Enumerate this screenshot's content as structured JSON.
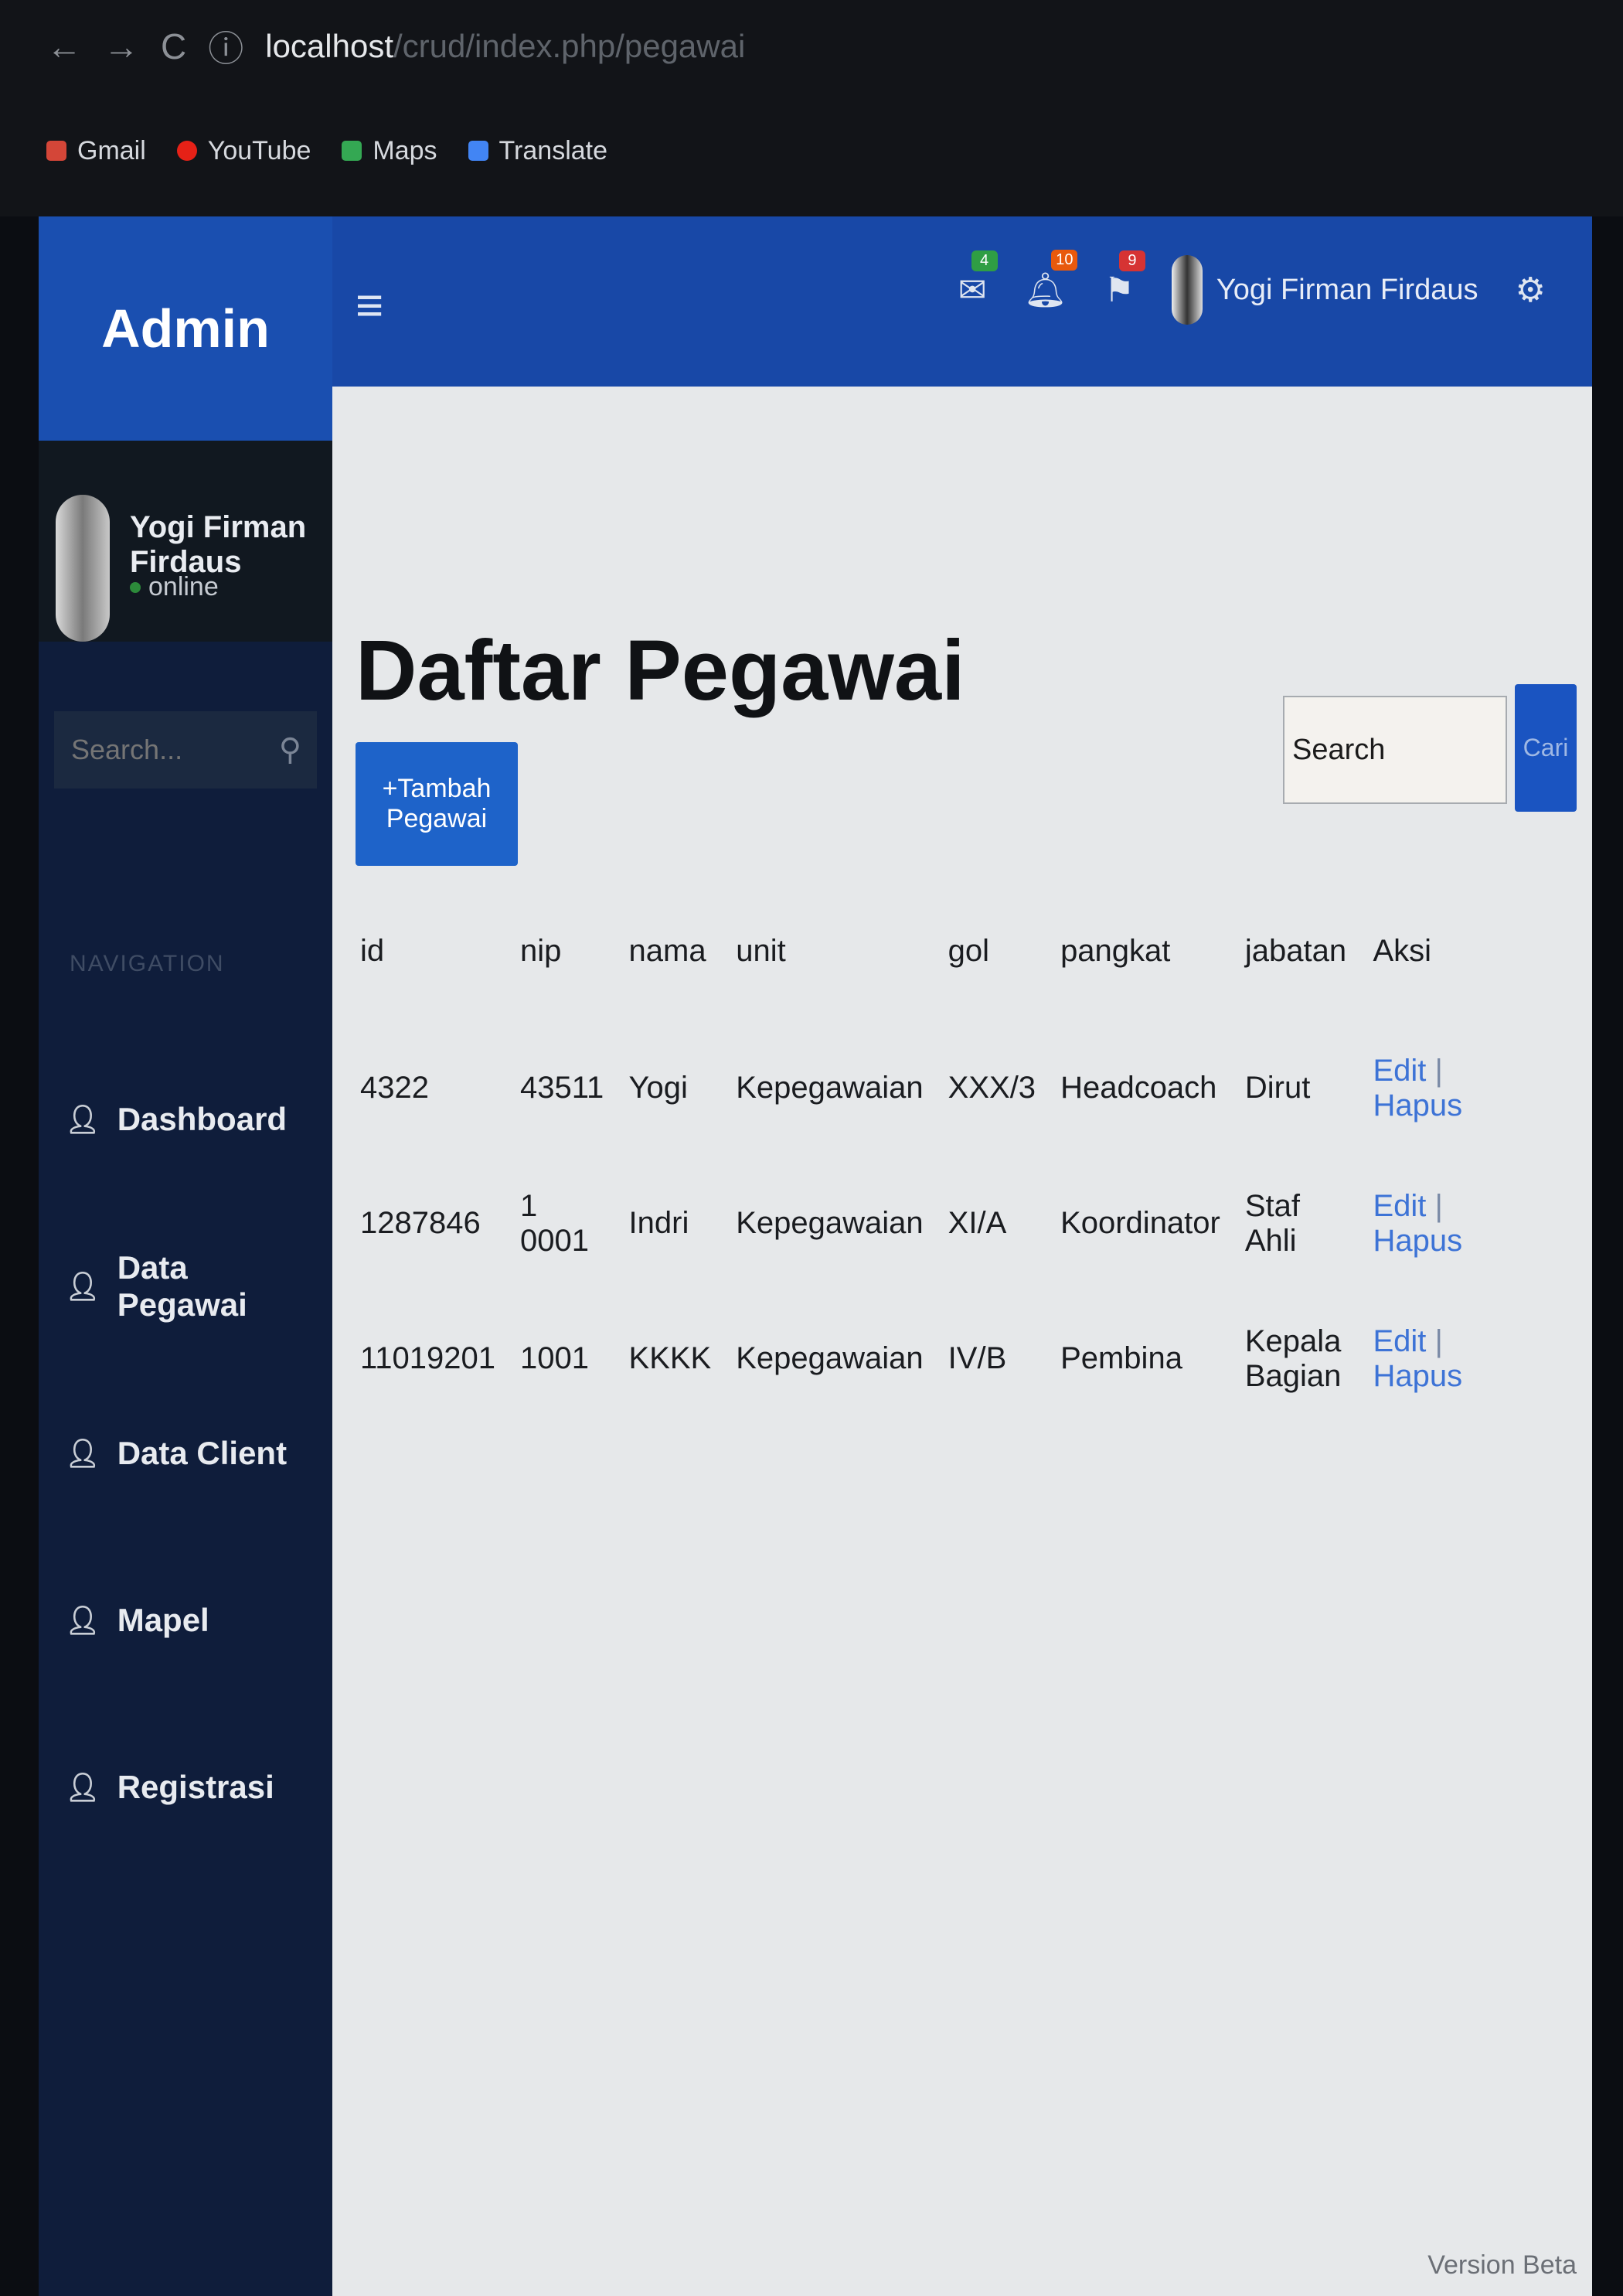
{
  "browser": {
    "url": "localhost",
    "url_path": "/crud/index.php/pegawai",
    "bookmarks": [
      {
        "label": "Gmail",
        "icon": "gmail-icon",
        "color": "#d44638"
      },
      {
        "label": "YouTube",
        "icon": "youtube-icon",
        "color": "#e62117"
      },
      {
        "label": "Maps",
        "icon": "maps-icon",
        "color": "#34a853"
      },
      {
        "label": "Translate",
        "icon": "translate-icon",
        "color": "#4285f4"
      }
    ]
  },
  "sidebar": {
    "brand": "Admin",
    "user": {
      "name": "Yogi Firman Firdaus",
      "status": "online"
    },
    "search_placeholder": "Search...",
    "nav_header": "NAVIGATION",
    "items": [
      {
        "label": "Dashboard"
      },
      {
        "label": "Data Pegawai"
      },
      {
        "label": "Data Client"
      },
      {
        "label": "Mapel"
      },
      {
        "label": "Registrasi"
      }
    ]
  },
  "topbar": {
    "messages_count": "4",
    "notifications_count": "10",
    "tasks_count": "9",
    "user_name": "Yogi Firman Firdaus",
    "colors": {
      "messages_badge": "#2f9e44",
      "notifications_badge": "#e8590c",
      "tasks_badge": "#d63333"
    }
  },
  "main": {
    "title": "Daftar Pegawai",
    "add_button": "+Tambah Pegawai",
    "search_placeholder": "Search",
    "search_button": "Cari",
    "table": {
      "headers": [
        "id",
        "nip",
        "nama",
        "unit",
        "gol",
        "pangkat",
        "jabatan",
        "Aksi"
      ],
      "rows": [
        {
          "id": "4322",
          "nip": "43511",
          "nama": "Yogi",
          "unit": "Kepegawaian",
          "gol": "XXX/3",
          "pangkat": "Headcoach",
          "jabatan": "Dirut"
        },
        {
          "id": "1287846",
          "nip": "1 0001",
          "nama": "Indri",
          "unit": "Kepegawaian",
          "gol": "XI/A",
          "pangkat": "Koordinator",
          "jabatan": "Staf Ahli"
        },
        {
          "id": "11019201",
          "nip": "1001",
          "nama": "KKKK",
          "unit": "Kepegawaian",
          "gol": "IV/B",
          "pangkat": "Pembina",
          "jabatan": "Kepala Bagian"
        }
      ],
      "action_edit": "Edit",
      "action_separator": "|",
      "action_delete": "Hapus"
    },
    "footer_version": "Version Beta"
  },
  "colors": {
    "brand": "#1a4fb0",
    "topbar": "#1848a7",
    "primary_button": "#1e63c9",
    "sidebar": "#0f1d3b"
  }
}
